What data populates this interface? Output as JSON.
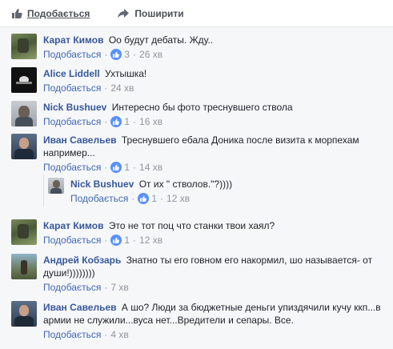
{
  "actions": {
    "like_label": "Подобається",
    "share_label": "Поширити"
  },
  "comments": [
    {
      "author": "Карат Кимов",
      "text": "Оо будут дебаты. Жду..",
      "like_label": "Подобається",
      "likes": "3",
      "time": "26 хв"
    },
    {
      "author": "Alice Liddell",
      "text": "Ухтышка!",
      "like_label": "Подобається",
      "likes": "",
      "time": "24 хв"
    },
    {
      "author": "Nick Bushuev",
      "text": "Интересно бы фото треснувшего ствола",
      "like_label": "Подобається",
      "likes": "1",
      "time": "16 хв"
    },
    {
      "author": "Иван Савельев",
      "text_line1": "Треснувшего ебала Доника после визита к морпехам",
      "text_line2": "например...",
      "like_label": "Подобається",
      "likes": "1",
      "time": "14 хв"
    },
    {
      "author": "Nick Bushuev",
      "text": "От их \" стволов.\"?))))",
      "like_label": "Подобається",
      "likes": "1",
      "time": "12 хв"
    },
    {
      "author": "Карат Кимов",
      "text": "Это не тот поц что станки твои хаял?",
      "like_label": "Подобається",
      "likes": "1",
      "time": "12 хв"
    },
    {
      "author": "Андрей Кобзарь",
      "text_line1": "Знатно ты его говном его накормил, шо называется- от",
      "text_line2": "души!))))))))",
      "like_label": "Подобається",
      "likes": "",
      "time": "7 хв"
    },
    {
      "author": "Иван Савельев",
      "text_line1": "А шо? Люди за бюджетные деньги упиздячили кучу ккп...в",
      "text_line2": "армии не служили...вуса нет...Вредители и сепары. Все.",
      "like_label": "Подобається",
      "likes": "",
      "time": "4 хв"
    }
  ],
  "colors": {
    "link": "#365899",
    "like_blue": "#4267b2",
    "meta_grey": "#90949c",
    "bg": "#f6f7f9"
  }
}
